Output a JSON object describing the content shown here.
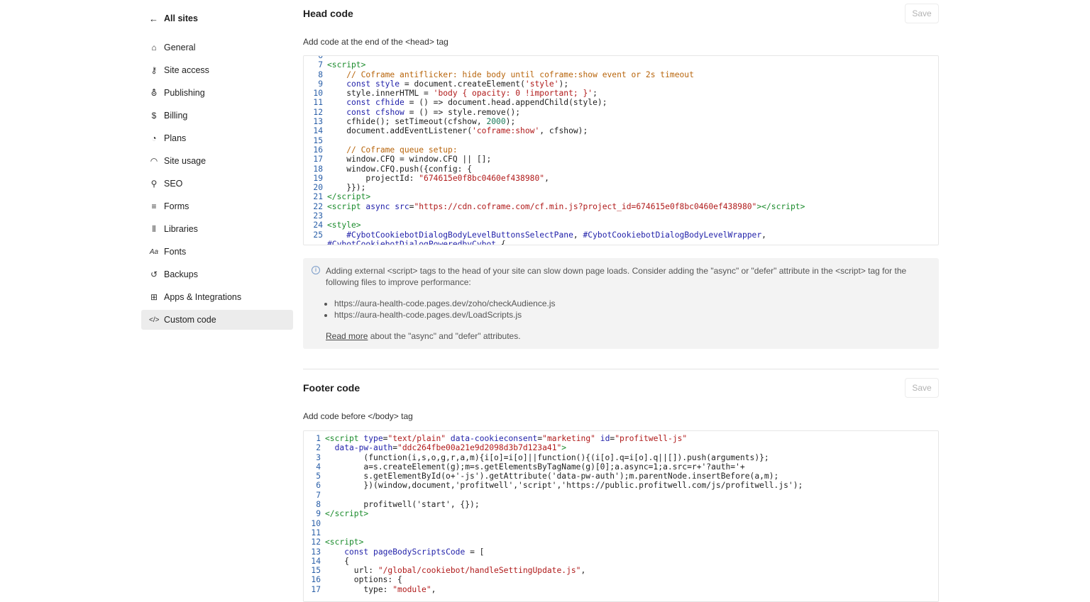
{
  "sidebar": {
    "back_label": "All sites",
    "items": [
      {
        "label": "General",
        "icon": "home-icon"
      },
      {
        "label": "Site access",
        "icon": "key-icon"
      },
      {
        "label": "Publishing",
        "icon": "publish-icon"
      },
      {
        "label": "Billing",
        "icon": "dollar-icon"
      },
      {
        "label": "Plans",
        "icon": "plans-icon"
      },
      {
        "label": "Site usage",
        "icon": "gauge-icon"
      },
      {
        "label": "SEO",
        "icon": "search-icon"
      },
      {
        "label": "Forms",
        "icon": "forms-icon"
      },
      {
        "label": "Libraries",
        "icon": "libraries-icon"
      },
      {
        "label": "Fonts",
        "icon": "fonts-icon"
      },
      {
        "label": "Backups",
        "icon": "backup-icon"
      },
      {
        "label": "Apps & Integrations",
        "icon": "apps-icon"
      },
      {
        "label": "Custom code",
        "icon": "code-icon",
        "active": true
      }
    ]
  },
  "head_code": {
    "title": "Head code",
    "save_label": "Save",
    "subtitle": "Add code at the end of the <head> tag"
  },
  "alert": {
    "text": "Adding external <script> tags to the head of your site can slow down page loads. Consider adding the \"async\" or \"defer\" attribute in the <script> tag for the following files to improve performance:",
    "files": [
      "https://aura-health-code.pages.dev/zoho/checkAudience.js",
      "https://aura-health-code.pages.dev/LoadScripts.js"
    ],
    "read_more": "Read more",
    "read_more_suffix": " about the \"async\" and \"defer\" attributes."
  },
  "footer_code": {
    "title": "Footer code",
    "save_label": "Save",
    "subtitle": "Add code before </body> tag"
  },
  "colors": {
    "line_number": "#2a5fa8",
    "tag": "#1a8b2b",
    "attr": "#2222aa",
    "string": "#b01a1a",
    "comment": "#b8650c",
    "active_nav_bg": "#ececec"
  }
}
